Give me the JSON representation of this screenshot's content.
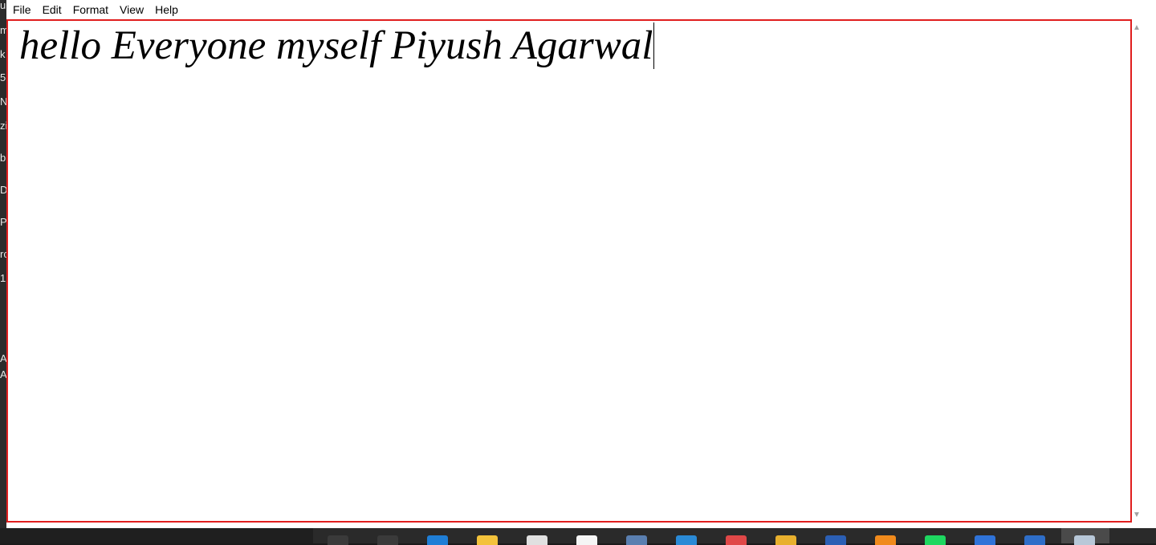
{
  "menu": {
    "items": [
      "File",
      "Edit",
      "Format",
      "View",
      "Help"
    ]
  },
  "editor": {
    "text": "hello Everyone myself Piyush Agarwal"
  },
  "background_fragments": [
    "u",
    "m",
    "k",
    "5",
    "N",
    "zi",
    "b",
    "Dr",
    "P(",
    "rc",
    "1",
    "A",
    "A"
  ],
  "taskbar": {
    "icons": [
      {
        "name": "search-icon",
        "color": "#3a3a3a"
      },
      {
        "name": "task-view-icon",
        "color": "#3a3a3a"
      },
      {
        "name": "edge-icon",
        "color": "#1f7ed6"
      },
      {
        "name": "folder-icon",
        "color": "#f3c23b"
      },
      {
        "name": "store-icon",
        "color": "#e0e0e0"
      },
      {
        "name": "app-icon",
        "color": "#f5f5f5"
      },
      {
        "name": "box-icon",
        "color": "#5a7fb0"
      },
      {
        "name": "vscode-icon",
        "color": "#2a8ad6"
      },
      {
        "name": "paint-icon",
        "color": "#e04848"
      },
      {
        "name": "chrome-icon",
        "color": "#e8b02e"
      },
      {
        "name": "word-icon",
        "color": "#2b5fb4"
      },
      {
        "name": "vlc-icon",
        "color": "#f08a1c"
      },
      {
        "name": "spotify-icon",
        "color": "#1ed760"
      },
      {
        "name": "hexagon-icon",
        "color": "#2f73d8"
      },
      {
        "name": "blue-app-icon",
        "color": "#2e6ec8"
      },
      {
        "name": "notepad-icon",
        "color": "#b8c8d8"
      }
    ]
  },
  "colors": {
    "highlight_border": "#e01e1e"
  }
}
